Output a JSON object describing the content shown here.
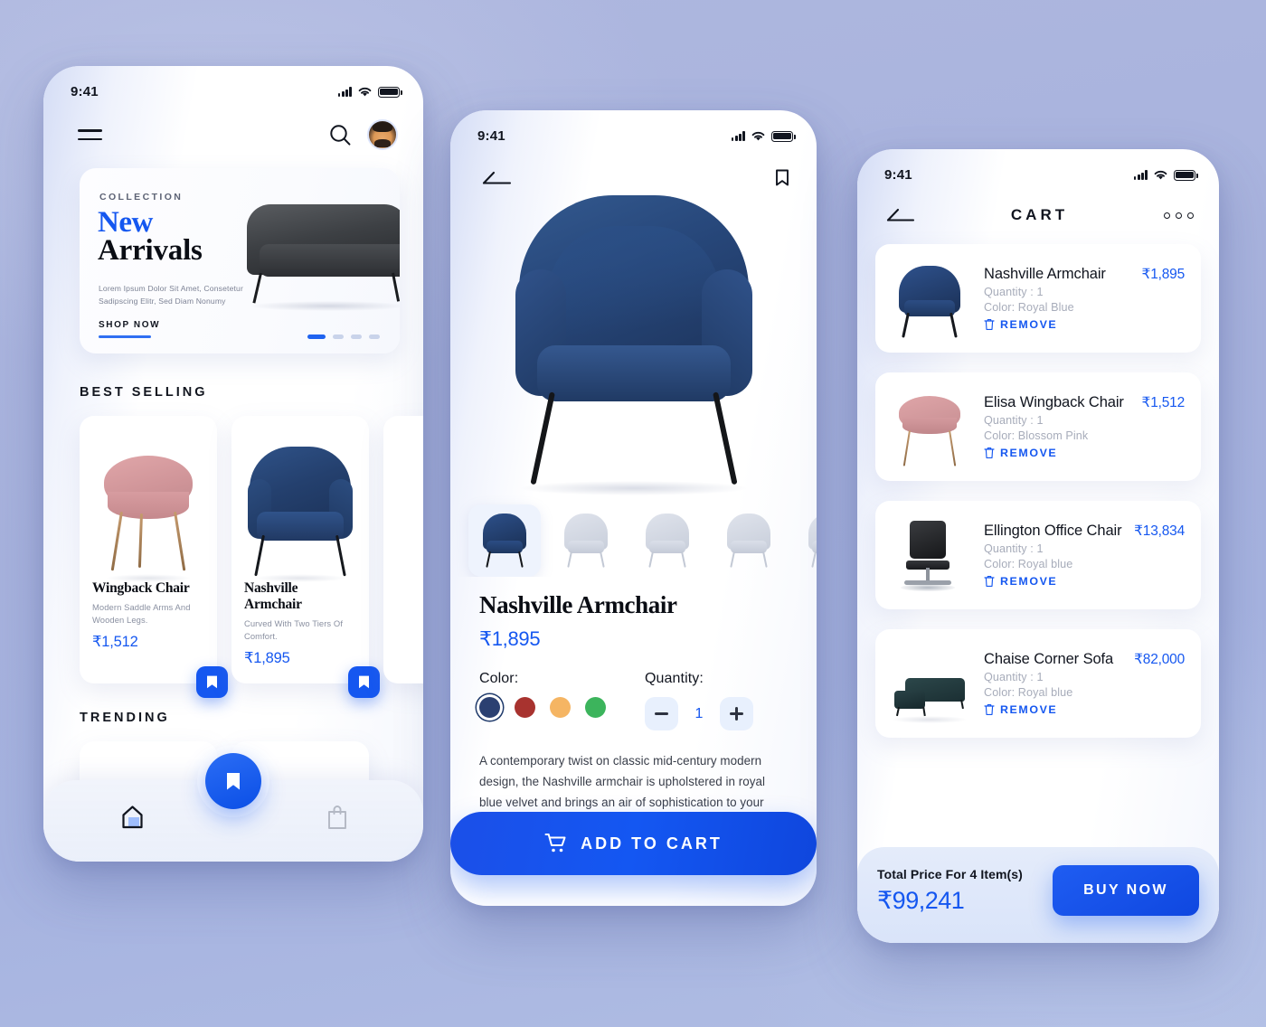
{
  "accent_color": "#1557f0",
  "background_color": "#a8b3de",
  "screens": {
    "home": {
      "status": {
        "time": "9:41",
        "signal_icon": "signal-bars-icon",
        "wifi_icon": "wifi-icon",
        "battery_icon": "battery-icon"
      },
      "nav": {
        "menu_icon": "hamburger-menu-icon",
        "search_icon": "search-icon",
        "avatar_icon": "user-avatar"
      },
      "banner": {
        "eyebrow": "COLLECTION",
        "title_line1": "New",
        "title_line2": "Arrivals",
        "subtitle": "Lorem Ipsum Dolor Sit Amet, Consetetur Sadipscing Elitr, Sed Diam Nonumy",
        "cta": "SHOP NOW",
        "dots": 4,
        "active_dot": 0
      },
      "sections": {
        "best_selling": "BEST SELLING",
        "trending": "TRENDING"
      },
      "products": [
        {
          "name": "Wingback Chair",
          "desc": "Modern Saddle Arms And Wooden Legs.",
          "price": "₹1,512",
          "bookmark_icon": "bookmark-icon"
        },
        {
          "name": "Nashville Armchair",
          "desc": "Curved With Two Tiers Of Comfort.",
          "price": "₹1,895",
          "bookmark_icon": "bookmark-icon"
        }
      ],
      "tabs": [
        {
          "name": "home",
          "icon": "home-icon",
          "active": true
        },
        {
          "name": "saved",
          "icon": "bookmark-icon",
          "active": true
        },
        {
          "name": "bag",
          "icon": "shopping-bag-icon",
          "active": false
        }
      ]
    },
    "product": {
      "status": {
        "time": "9:41",
        "signal_icon": "signal-bars-icon",
        "wifi_icon": "wifi-icon",
        "battery_icon": "battery-icon"
      },
      "nav": {
        "back_icon": "back-arrow-icon",
        "bookmark_icon": "bookmark-icon"
      },
      "thumbnails": [
        {
          "view": "front",
          "selected": true
        },
        {
          "view": "three-quarter",
          "selected": false
        },
        {
          "view": "side",
          "selected": false
        },
        {
          "view": "back",
          "selected": false
        },
        {
          "view": "angled",
          "selected": false
        }
      ],
      "title": "Nashville Armchair",
      "price": "₹1,895",
      "color_label": "Color:",
      "colors": [
        {
          "name": "royal-blue",
          "hex": "#2b4071",
          "selected": true
        },
        {
          "name": "red",
          "hex": "#a8332f",
          "selected": false
        },
        {
          "name": "orange",
          "hex": "#f5b563",
          "selected": false
        },
        {
          "name": "green",
          "hex": "#3cb45c",
          "selected": false
        }
      ],
      "quantity_label": "Quantity:",
      "quantity_value": "1",
      "minus_icon": "minus-icon",
      "plus_icon": "plus-icon",
      "description": "A contemporary twist on classic mid-century modern design, the Nashville armchair is upholstered in royal blue velvet and brings an air of sophistication to your living space. Available in a choice of rich velvet colours, the",
      "add_to_cart": {
        "label": "ADD TO CART",
        "icon": "shopping-cart-icon"
      }
    },
    "cart": {
      "status": {
        "time": "9:41",
        "signal_icon": "signal-bars-icon",
        "wifi_icon": "wifi-icon",
        "battery_icon": "battery-icon"
      },
      "header": {
        "back_icon": "back-arrow-icon",
        "title": "CART",
        "more_icon": "more-options-icon"
      },
      "items": [
        {
          "name": "Nashville Armchair",
          "price": "₹1,895",
          "quantity": "Quantity : 1",
          "color": "Color: Royal Blue",
          "remove_label": "REMOVE",
          "remove_icon": "trash-icon",
          "thumb": "navy-armchair"
        },
        {
          "name": "Elisa Wingback Chair",
          "price": "₹1,512",
          "quantity": "Quantity : 1",
          "color": "Color: Blossom Pink",
          "remove_label": "REMOVE",
          "remove_icon": "trash-icon",
          "thumb": "pink-chair"
        },
        {
          "name": "Ellington Office Chair",
          "price": "₹13,834",
          "quantity": "Quantity : 1",
          "color": "Color: Royal blue",
          "remove_label": "REMOVE",
          "remove_icon": "trash-icon",
          "thumb": "office-chair"
        },
        {
          "name": "Chaise Corner Sofa",
          "price": "₹82,000",
          "quantity": "Quantity : 1",
          "color": "Color: Royal blue",
          "remove_label": "REMOVE",
          "remove_icon": "trash-icon",
          "thumb": "corner-sofa"
        }
      ],
      "footer": {
        "total_label": "Total Price For 4 Item(s)",
        "total_value": "₹99,241",
        "buy_label": "BUY NOW"
      }
    }
  }
}
